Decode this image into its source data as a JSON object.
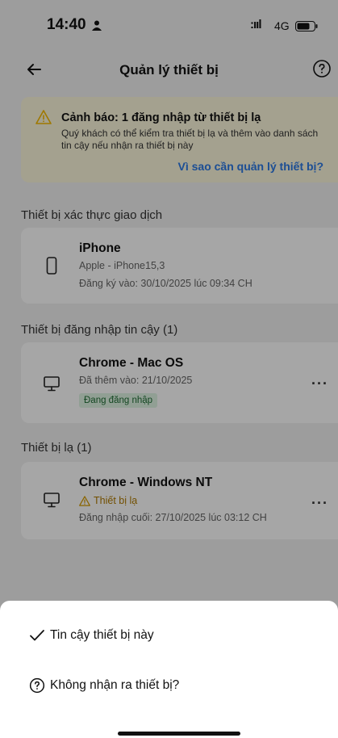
{
  "status_bar": {
    "time": "14:40",
    "signal": ":ııl",
    "network": "4G"
  },
  "header": {
    "title": "Quản lý thiết bị"
  },
  "warning": {
    "title": "Cảnh báo: 1 đăng nhập từ thiết bị lạ",
    "description": "Quý khách có thể kiểm tra thiết bị lạ và thêm vào danh sách tin cậy nếu nhận ra thiết bị này",
    "link": "Vì sao cần quản lý thiết bị?"
  },
  "sections": {
    "transaction": {
      "title": "Thiết bị xác thực giao dịch",
      "device": {
        "name": "iPhone",
        "model": "Apple - iPhone15,3",
        "registered": "Đăng ký vào: 30/10/2025 lúc 09:34 CH"
      }
    },
    "trusted": {
      "title": "Thiết bị đăng nhập tin cậy (1)",
      "device": {
        "name": "Chrome - Mac OS",
        "added": "Đã thêm vào: 21/10/2025",
        "badge": "Đang đăng nhập",
        "more": "..."
      }
    },
    "unknown": {
      "title": "Thiết bị lạ (1)",
      "device": {
        "name": "Chrome - Windows NT",
        "status": "Thiết bị lạ",
        "last_login": "Đăng nhập cuối: 27/10/2025 lúc 03:12 CH",
        "more": "..."
      }
    }
  },
  "sheet": {
    "trust_label": "Tin cậy thiết bị này",
    "unknown_label": "Không nhận ra thiết bị?"
  },
  "icons": {
    "back": "arrow-left-icon",
    "help": "question-circle-icon",
    "warning": "warning-triangle-icon",
    "phone": "phone-icon",
    "monitor": "monitor-icon",
    "check": "check-icon"
  },
  "colors": {
    "accent": "#2b78e4",
    "warning_bg": "#fcf7dc",
    "badge_bg": "#dff5e4",
    "warning_icon": "#f5b800"
  }
}
